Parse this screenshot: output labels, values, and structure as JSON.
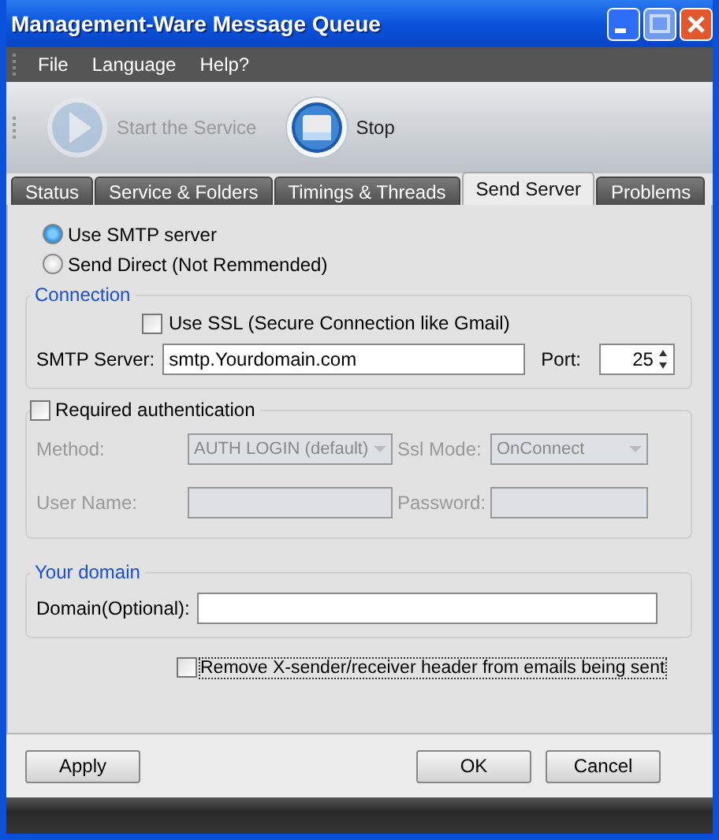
{
  "window": {
    "title": "Management-Ware Message Queue"
  },
  "menu": [
    "File",
    "Language",
    "Help?"
  ],
  "toolbar": [
    {
      "label": "Start the Service",
      "kind": "play",
      "disabled": true
    },
    {
      "label": "Stop",
      "kind": "stop",
      "disabled": false
    }
  ],
  "tabs": [
    {
      "label": "Status",
      "selected": false
    },
    {
      "label": "Service & Folders",
      "selected": false
    },
    {
      "label": "Timings & Threads",
      "selected": false
    },
    {
      "label": "Send Server",
      "selected": true
    },
    {
      "label": "Problems",
      "selected": false
    }
  ],
  "send_mode": [
    {
      "label": "Use SMTP server",
      "selected": true
    },
    {
      "label": "Send Direct (Not Remmended)",
      "selected": false
    }
  ],
  "connection": {
    "title": "Connection",
    "use_ssl": {
      "label": "Use SSL (Secure Connection like Gmail)",
      "checked": false
    },
    "server_label": "SMTP Server:",
    "server_value": "smtp.Yourdomain.com",
    "port_label": "Port:",
    "port_value": "25"
  },
  "authentication": {
    "label": "Required authentication",
    "checked": false,
    "method_label": "Method:",
    "method_value": "AUTH LOGIN (default)",
    "ssl_mode_label": "Ssl Mode:",
    "ssl_mode_value": "OnConnect",
    "user_label": "User Name:",
    "password_label": "Password:"
  },
  "domain": {
    "title": "Your domain",
    "label": "Domain(Optional):"
  },
  "remove_header": {
    "label": "Remove X-sender/receiver header from emails being sent",
    "checked": false,
    "focused": true
  },
  "buttons": [
    {
      "label": "Apply",
      "kind": "left"
    },
    {
      "label": "OK",
      "kind": "right"
    },
    {
      "label": "Cancel",
      "kind": "right"
    }
  ]
}
